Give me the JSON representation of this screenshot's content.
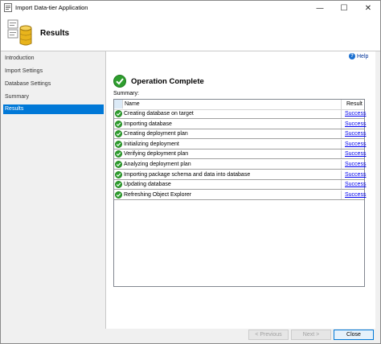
{
  "window": {
    "title": "Import Data-tier Application",
    "controls": {
      "minimize": "—",
      "maximize": "☐",
      "close": "✕"
    }
  },
  "header": {
    "title": "Results"
  },
  "sidebar": {
    "items": [
      {
        "label": "Introduction",
        "active": false
      },
      {
        "label": "Import Settings",
        "active": false
      },
      {
        "label": "Database Settings",
        "active": false
      },
      {
        "label": "Summary",
        "active": false
      },
      {
        "label": "Results",
        "active": true
      }
    ]
  },
  "content": {
    "help_label": "Help",
    "status_title": "Operation Complete",
    "summary_label": "Summary:",
    "columns": {
      "name": "Name",
      "result": "Result"
    },
    "rows": [
      {
        "name": "Creating database on target",
        "result": "Success",
        "icon": "success-check-icon"
      },
      {
        "name": "Importing database",
        "result": "Success",
        "icon": "success-check-icon"
      },
      {
        "name": "Creating deployment plan",
        "result": "Success",
        "icon": "success-check-icon"
      },
      {
        "name": "Initializing deployment",
        "result": "Success",
        "icon": "success-check-icon"
      },
      {
        "name": "Verifying deployment plan",
        "result": "Success",
        "icon": "success-check-icon"
      },
      {
        "name": "Analyzing deployment plan",
        "result": "Success",
        "icon": "success-check-icon"
      },
      {
        "name": "Importing package schema and data into database",
        "result": "Success",
        "icon": "success-check-icon"
      },
      {
        "name": "Updating database",
        "result": "Success",
        "icon": "success-check-icon"
      },
      {
        "name": "Refreshing Object Explorer",
        "result": "Success",
        "icon": "success-check-icon"
      }
    ]
  },
  "footer": {
    "previous_label": "< Previous",
    "next_label": "Next >",
    "close_label": "Close"
  },
  "colors": {
    "accent": "#0078d7",
    "success_green": "#2e9e2e",
    "link": "#0000ee"
  }
}
